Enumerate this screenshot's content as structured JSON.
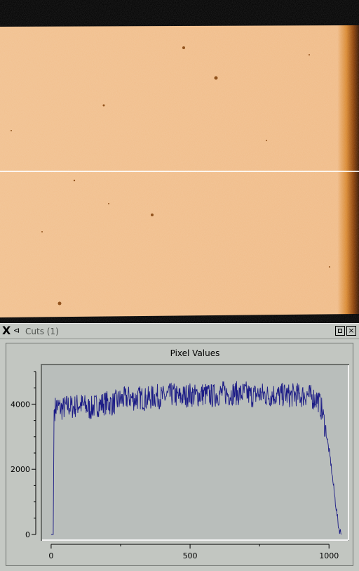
{
  "window": {
    "title": "Cuts (1)",
    "close_glyph": "×",
    "pin_glyph": "⊲",
    "x_glyph": "X"
  },
  "colors": {
    "image_bright": "#f3c596",
    "image_dark": "#3a1600",
    "plot_background": "#b9bebb",
    "plot_line": "#1c1c86",
    "panel": "#c5c9c4"
  },
  "chart_data": {
    "type": "line",
    "title": "Pixel Values",
    "xlabel": "",
    "ylabel": "",
    "xlim": [
      -20,
      1060
    ],
    "ylim": [
      0,
      5000
    ],
    "xticks": [
      0,
      500,
      1000
    ],
    "yticks": [
      0,
      2000,
      4000
    ],
    "series": [
      {
        "values": [
          [
            0,
            0
          ],
          [
            8,
            0
          ],
          [
            10,
            3800
          ],
          [
            20,
            3950
          ],
          [
            40,
            3850
          ],
          [
            60,
            3950
          ],
          [
            80,
            3900
          ],
          [
            100,
            4000
          ],
          [
            120,
            3950
          ],
          [
            140,
            3850
          ],
          [
            160,
            3950
          ],
          [
            180,
            4000
          ],
          [
            200,
            4050
          ],
          [
            220,
            4000
          ],
          [
            240,
            4100
          ],
          [
            260,
            4150
          ],
          [
            280,
            4200
          ],
          [
            300,
            4150
          ],
          [
            320,
            4200
          ],
          [
            340,
            4150
          ],
          [
            360,
            4200
          ],
          [
            380,
            4250
          ],
          [
            400,
            4200
          ],
          [
            420,
            4250
          ],
          [
            440,
            4300
          ],
          [
            460,
            4200
          ],
          [
            480,
            4250
          ],
          [
            500,
            4300
          ],
          [
            520,
            4250
          ],
          [
            540,
            4300
          ],
          [
            560,
            4300
          ],
          [
            580,
            4250
          ],
          [
            600,
            4300
          ],
          [
            620,
            4350
          ],
          [
            640,
            4300
          ],
          [
            660,
            4350
          ],
          [
            680,
            4300
          ],
          [
            700,
            4350
          ],
          [
            720,
            4250
          ],
          [
            740,
            4300
          ],
          [
            760,
            4300
          ],
          [
            780,
            4250
          ],
          [
            800,
            4300
          ],
          [
            820,
            4250
          ],
          [
            840,
            4300
          ],
          [
            860,
            4250
          ],
          [
            880,
            4300
          ],
          [
            900,
            4250
          ],
          [
            920,
            4300
          ],
          [
            940,
            4200
          ],
          [
            960,
            4150
          ],
          [
            975,
            3800
          ],
          [
            990,
            3100
          ],
          [
            1005,
            2300
          ],
          [
            1020,
            1200
          ],
          [
            1035,
            200
          ],
          [
            1045,
            0
          ]
        ]
      }
    ]
  }
}
